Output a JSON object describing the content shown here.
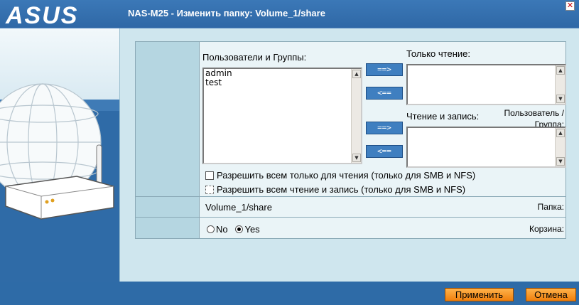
{
  "header": {
    "logo_text": "ASUS",
    "title": "NAS-M25 - Изменить папку: Volume_1/share",
    "close_glyph": "✕"
  },
  "form": {
    "users_groups_caption": "Пользователи и Группы:",
    "users_groups_list": [
      "admin",
      "test"
    ],
    "read_only_caption": "Только чтение:",
    "read_write_caption": "Чтение и запись:",
    "add_read_only_label": "==>",
    "remove_read_only_label": "<==",
    "add_read_write_label": "==>",
    "remove_read_write_label": "<==",
    "user_group_label": "Пользователь / Группа:",
    "allow_all_read_only": "Разрешить всем только для чтения (только для SMB и NFS)",
    "allow_all_read_write": "Разрешить всем чтение и запись (только для SMB и NFS)",
    "folder_label": "Папка:",
    "folder_value": "Volume_1/share",
    "recycle_label": "Корзина:",
    "recycle_no": "No",
    "recycle_yes": "Yes",
    "recycle_selected": "Yes"
  },
  "footer": {
    "apply_label": "Применить",
    "cancel_label": "Отмена"
  },
  "colors": {
    "banner": "#3b78b7",
    "accent_button": "#f07f0d",
    "move_button": "#3f7fc0",
    "label_column": "#b5d6e1"
  }
}
